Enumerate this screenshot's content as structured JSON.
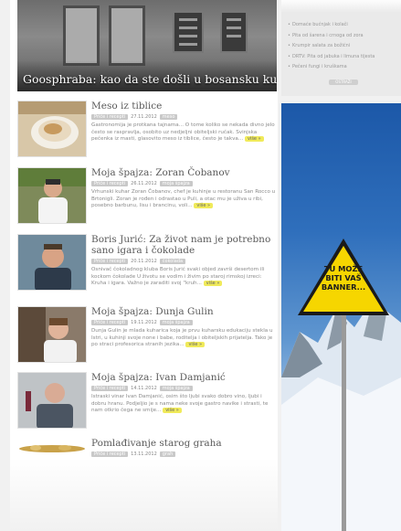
{
  "hero": {
    "title": "Goosphraba: kao da ste došli u bosansku kuću"
  },
  "articles": [
    {
      "title": "Meso iz tiblice",
      "category": "Priče i recepti",
      "date": "27.11.2012",
      "tag": "meso",
      "text": "Gastronomija je protkana tajnama... O tome koliko se nekada divno jelo često se raspravlja, osobito uz nedjeljni obiteljski ručak. Svinjska pečenka iz masti, glasovito meso iz tiblice, često je takva...",
      "more": "više »"
    },
    {
      "title": "Moja špajza: Zoran Čobanov",
      "category": "Priče i recepti",
      "date": "26.11.2012",
      "tag": "moja špajza",
      "text": "Vrhunski kuhar Zoran Čobanov, chef je kuhinje u restoranu San Rocco u Brtonigli. Zoran je rođen i odrastao u Puli, a otac mu je uživa u ribi, posebno barbunu, lisu i brancinu, voli...",
      "more": "više »"
    },
    {
      "title": "Boris Jurić: Za život nam je potrebno sano igara i čokolade",
      "category": "Priče i recepti",
      "date": "20.11.2012",
      "tag": "čokolada",
      "text": "Osnivač čokoladnog kluba Boris Jurić svaki objed završi desertom ili kockom čokolade U životu se vodim i živim po staroj rimskoj izreci: Kruha i igara. Važno je zaraditi svoj \"kruh...",
      "more": "više »"
    },
    {
      "title": "Moja špajza: Dunja Gulin",
      "category": "Priče i recepti",
      "date": "19.11.2012",
      "tag": "moja špajza",
      "text": "Dunja Gulin je mlada kuharica koja je prvu kuharsku edukaciju stekla u Istri, u kuhinji svoje none i babe, roditelja i obiteljskih prijatelja. Tako je po straci profesorica stranih jezika...",
      "more": "više »"
    },
    {
      "title": "Moja špajza: Ivan Damjanić",
      "category": "Priče i recepti",
      "date": "14.11.2012",
      "tag": "moja špajza",
      "text": "Istraski vinar Ivan Damjanić, osim što ljubi svako dobro vino, ljubi i dobru hranu. Podjeljio je s nama neke svoje gastro navike i strasti, te nam otkrio čega ne smije...",
      "more": "više »"
    },
    {
      "title": "Pomlađivanje starog graha",
      "category": "Priče i recepti",
      "date": "13.11.2012",
      "tag": "grah",
      "text": "",
      "more": ""
    }
  ],
  "sidebar": {
    "items": [
      "Domaće bućnjak i kolači",
      "Pita od šarena i crnoga od zora",
      "Krumpir salata za božićni",
      "DRTV: Pita od jabuka i limuna tijesta",
      "Pečeni fungi i kruškama"
    ],
    "button": "OSTRAŽI"
  },
  "banner": {
    "text": "TU MOŽE BITI VAŠ BANNER..."
  },
  "colors": {
    "accent_more": "#f0ea5a",
    "meta_badge": "#c9c9c9",
    "sign_yellow": "#f6d600",
    "sky": "#2f6fbc"
  }
}
